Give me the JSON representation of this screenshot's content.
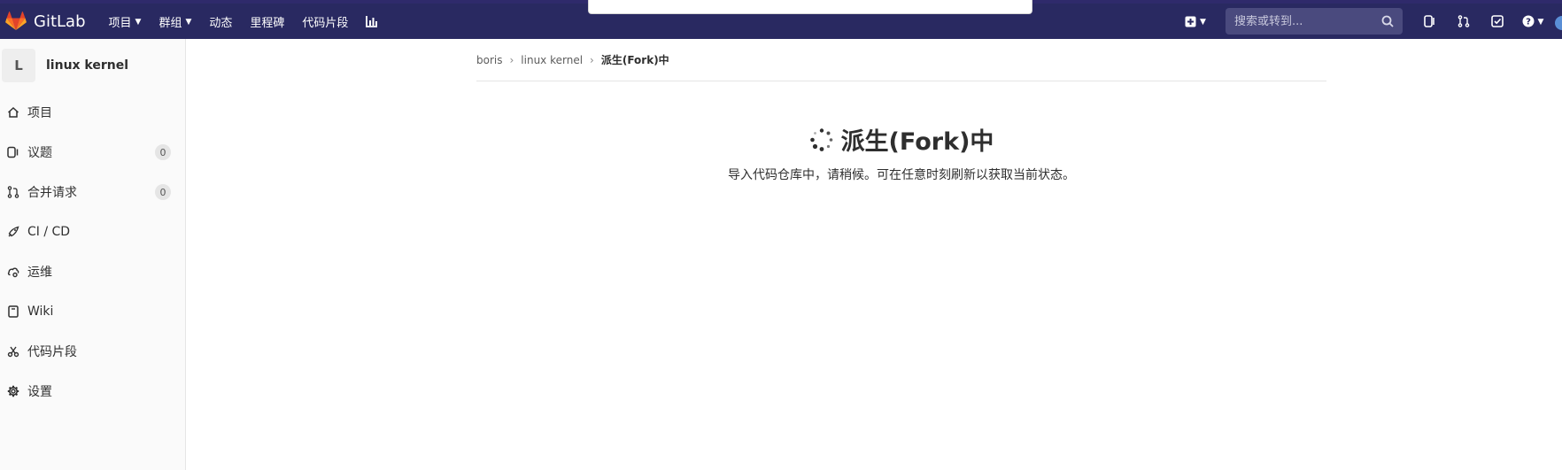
{
  "brand": {
    "name": "GitLab",
    "logo_icon": "gitlab-logo-icon"
  },
  "navbar": {
    "links": [
      {
        "label": "项目",
        "has_caret": true
      },
      {
        "label": "群组",
        "has_caret": true
      },
      {
        "label": "动态",
        "has_caret": false
      },
      {
        "label": "里程碑",
        "has_caret": false
      },
      {
        "label": "代码片段",
        "has_caret": false
      }
    ],
    "search": {
      "placeholder": "搜索或转到..."
    },
    "colors": {
      "background": "#292961",
      "search_bg": "#4a4a7e"
    }
  },
  "sidebar": {
    "avatar_letter": "L",
    "project_name": "linux kernel",
    "items": [
      {
        "label": "项目",
        "icon": "home-icon"
      },
      {
        "label": "议题",
        "icon": "issues-icon",
        "count": "0"
      },
      {
        "label": "合并请求",
        "icon": "merge-request-icon",
        "count": "0"
      },
      {
        "label": "CI / CD",
        "icon": "rocket-icon"
      },
      {
        "label": "运维",
        "icon": "cloud-gear-icon"
      },
      {
        "label": "Wiki",
        "icon": "book-icon"
      },
      {
        "label": "代码片段",
        "icon": "scissors-icon"
      },
      {
        "label": "设置",
        "icon": "gear-icon"
      }
    ]
  },
  "breadcrumb": {
    "items": [
      "boris",
      "linux kernel"
    ],
    "current": "派生(Fork)中"
  },
  "fork": {
    "title": "派生(Fork)中",
    "description": "导入代码仓库中，请稍候。可在任意时刻刷新以获取当前状态。"
  }
}
